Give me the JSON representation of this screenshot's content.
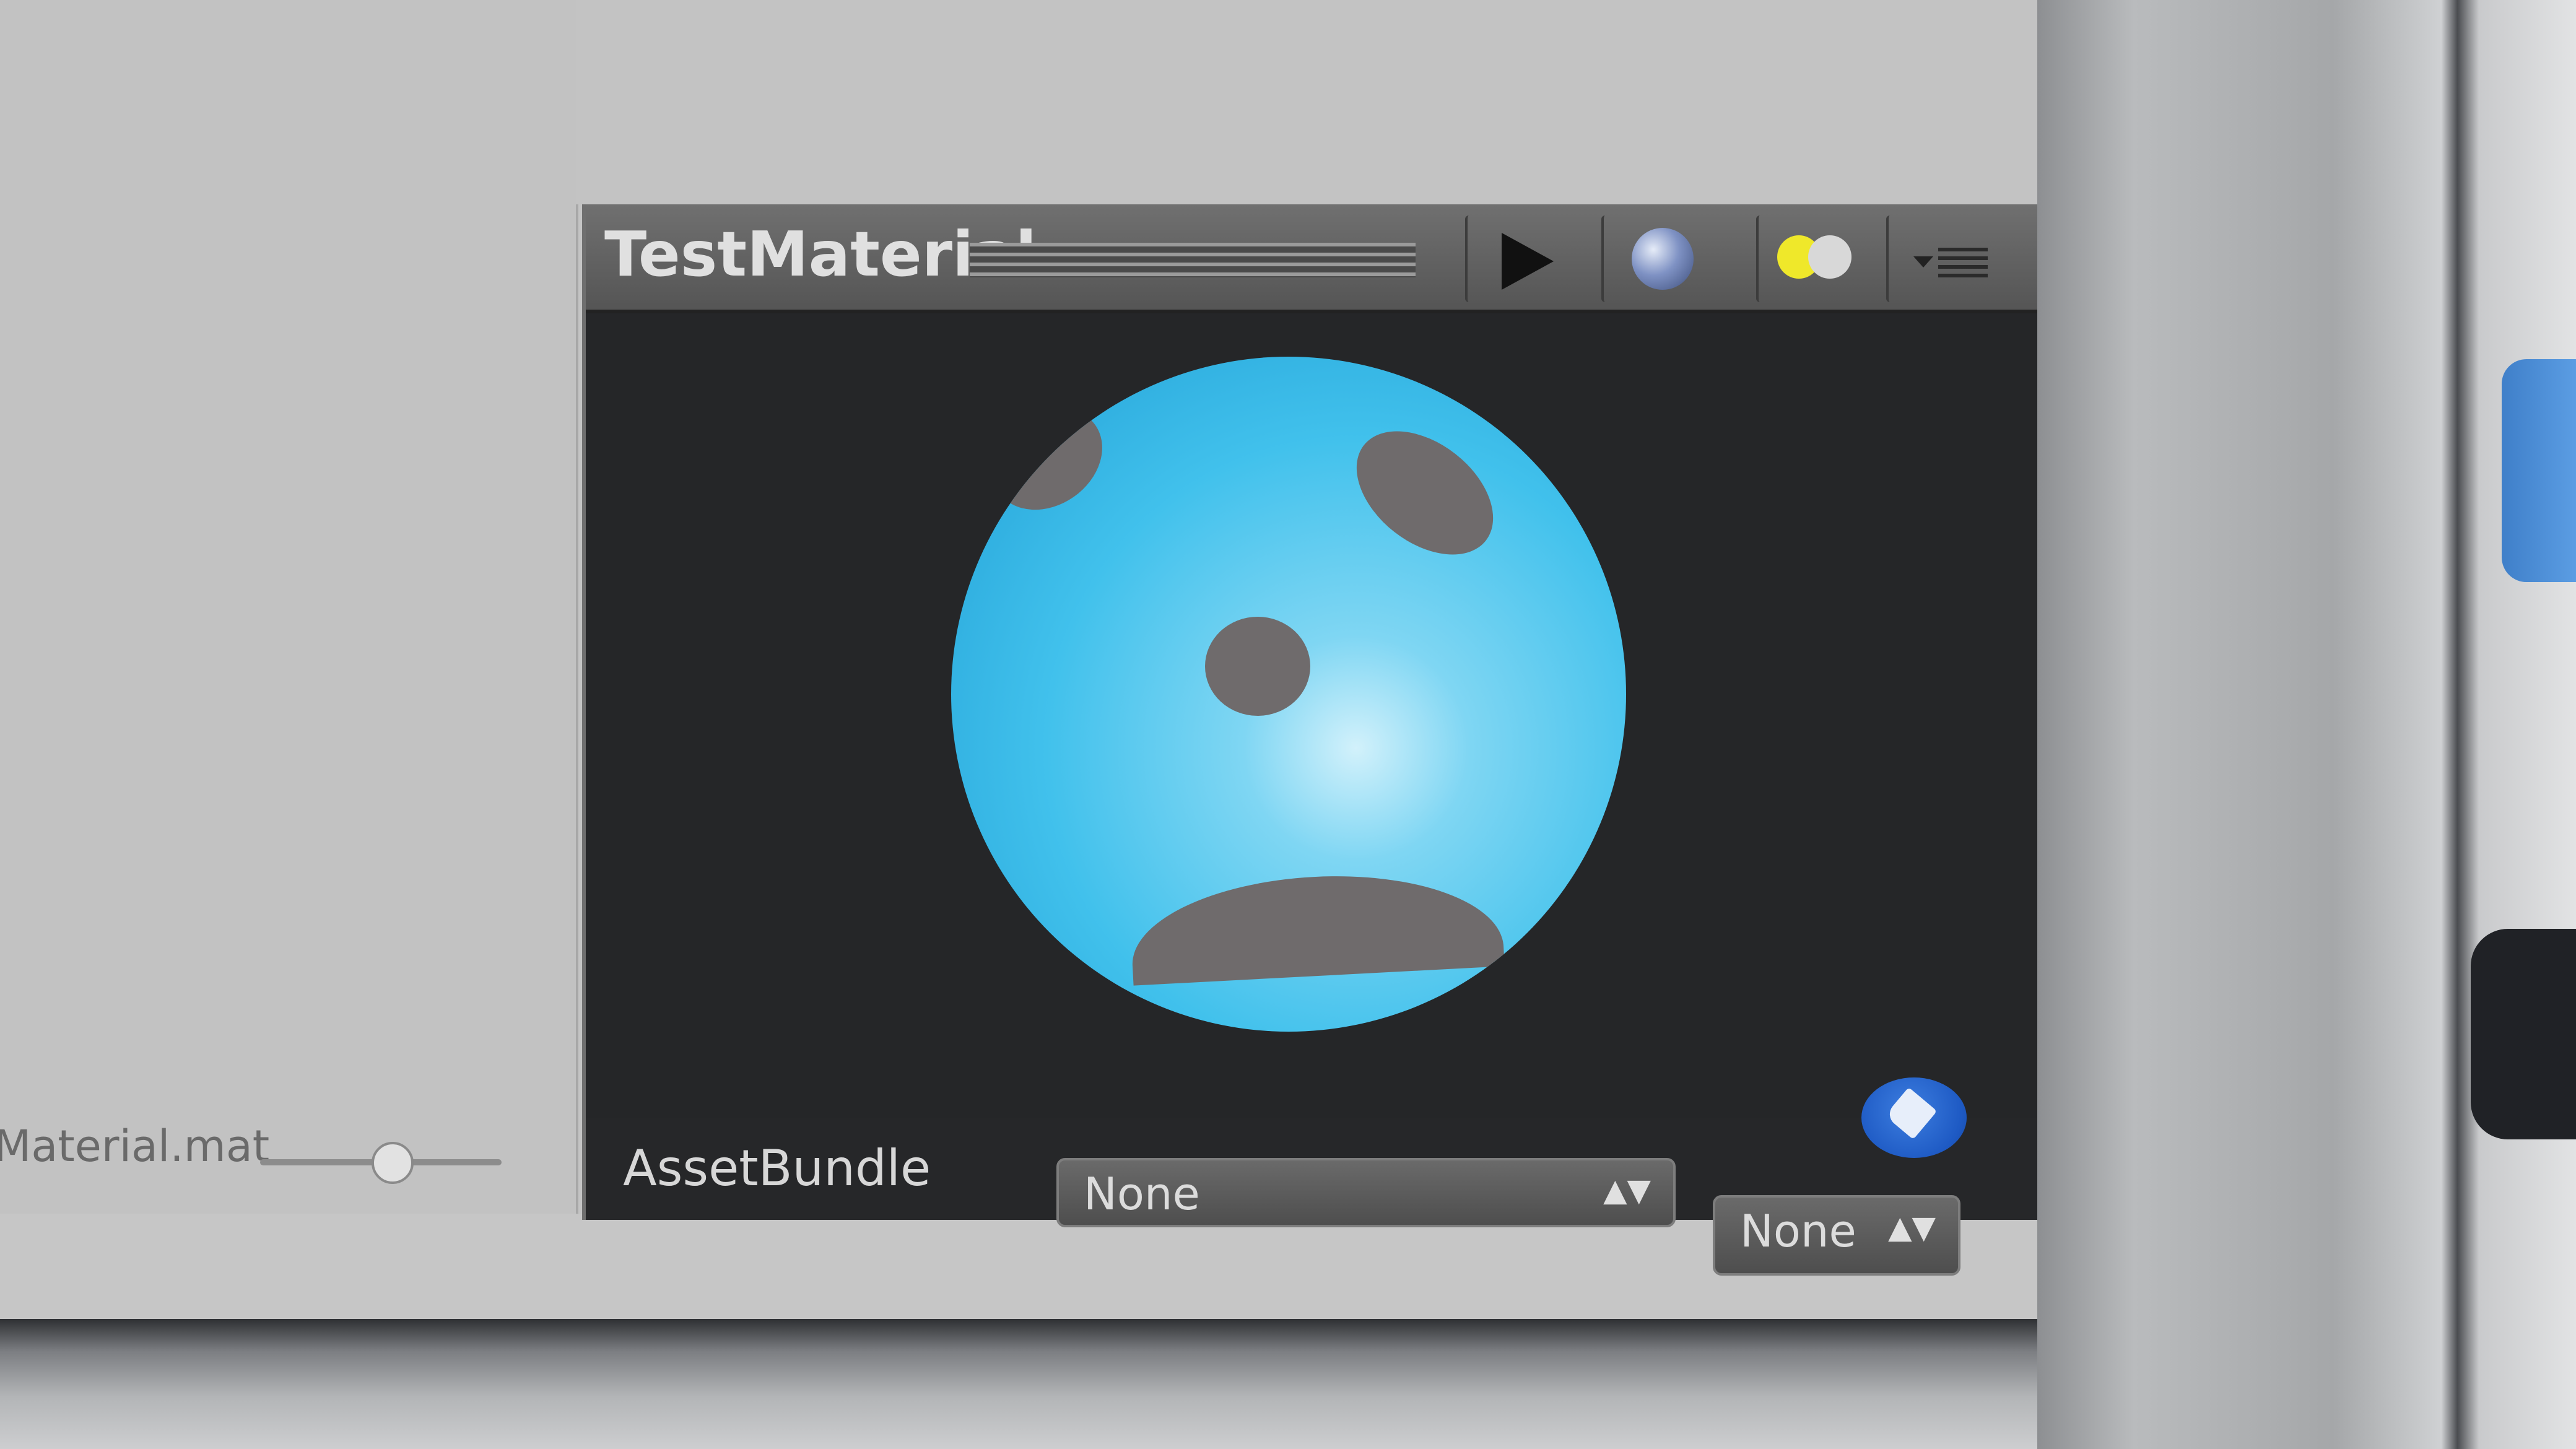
{
  "project": {
    "asset_name": "Material.mat"
  },
  "preview": {
    "title": "TestMaterial",
    "buttons": {
      "play_icon": "play-icon",
      "sphere_icon": "sphere-icon",
      "light_icon": "light-icon",
      "menu_icon": "menu-icon"
    }
  },
  "asset_bundle": {
    "label": "AssetBundle",
    "name_value": "None",
    "variant_value": "None",
    "arrows": "▲▼"
  },
  "colors": {
    "sphere": "#41c1ec",
    "face_marks": "#6f6b6c",
    "tag_badge": "#1e5ac4"
  }
}
